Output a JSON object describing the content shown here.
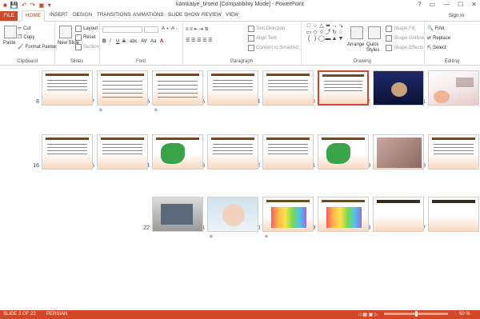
{
  "window": {
    "title": "kamkaiye_tiroeid [Compatibility Mode] - PowerPoint",
    "controls": [
      "?",
      "▭",
      "—",
      "☐",
      "✕"
    ]
  },
  "tabs": {
    "file": "FILE",
    "items": [
      "HOME",
      "INSERT",
      "DESIGN",
      "TRANSITIONS",
      "ANIMATIONS",
      "SLIDE SHOW",
      "REVIEW",
      "VIEW"
    ],
    "active": "HOME",
    "sign_in": "Sign in"
  },
  "ribbon": {
    "clipboard": {
      "label": "Clipboard",
      "paste": "Paste",
      "cut": "Cut",
      "copy": "Copy",
      "format_painter": "Format Painter"
    },
    "slides": {
      "label": "Slides",
      "new_slide": "New Slide",
      "layout": "Layout",
      "reset": "Reset",
      "section": "Section"
    },
    "font": {
      "label": "Font",
      "bold": "B",
      "italic": "I",
      "underline": "U",
      "strike": "S",
      "shadow": "abc",
      "spacing": "AV",
      "case": "Aa",
      "color": "A"
    },
    "paragraph": {
      "label": "Paragraph",
      "text_direction": "Text Direction",
      "align_text": "Align Text",
      "convert_smartart": "Convert to SmartArt"
    },
    "drawing": {
      "label": "Drawing",
      "arrange": "Arrange",
      "quick_styles": "Quick Styles",
      "shape_fill": "Shape Fill",
      "shape_outline": "Shape Outline",
      "shape_effects": "Shape Effects"
    },
    "editing": {
      "label": "Editing",
      "find": "Find",
      "replace": "Replace",
      "select": "Select"
    }
  },
  "slides": [
    {
      "number": "1",
      "star": false,
      "theme": "flower"
    },
    {
      "number": "2",
      "star": false,
      "theme": "dark"
    },
    {
      "number": "3",
      "star": false,
      "theme": "text",
      "selected": true
    },
    {
      "number": "4",
      "star": false,
      "theme": "text"
    },
    {
      "number": "5",
      "star": false,
      "theme": "text"
    },
    {
      "number": "6",
      "star": true,
      "theme": "table"
    },
    {
      "number": "7",
      "star": true,
      "theme": "table"
    },
    {
      "number": "8",
      "star": false,
      "theme": "text"
    },
    {
      "number": "9",
      "star": false,
      "theme": "text"
    },
    {
      "number": "10",
      "star": false,
      "theme": "photo"
    },
    {
      "number": "11",
      "star": false,
      "theme": "map"
    },
    {
      "number": "12",
      "star": false,
      "theme": "text"
    },
    {
      "number": "13",
      "star": false,
      "theme": "text"
    },
    {
      "number": "14",
      "star": false,
      "theme": "map"
    },
    {
      "number": "15",
      "star": false,
      "theme": "text"
    },
    {
      "number": "16",
      "star": false,
      "theme": "text"
    },
    {
      "number": "17",
      "star": false,
      "theme": "blank"
    },
    {
      "number": "18",
      "star": false,
      "theme": "blank"
    },
    {
      "number": "19",
      "star": false,
      "theme": "chart"
    },
    {
      "number": "20",
      "star": true,
      "theme": "chart"
    },
    {
      "number": "21",
      "star": true,
      "theme": "baby"
    },
    {
      "number": "22",
      "star": false,
      "theme": "laptop"
    }
  ],
  "status": {
    "slide_indicator": "SLIDE 3 OF 22",
    "language": "PERSIAN",
    "zoom": "50 %",
    "zoom_level": 0.5
  },
  "colors": {
    "accent": "#D24726",
    "selected_border": "#C94C2A"
  }
}
